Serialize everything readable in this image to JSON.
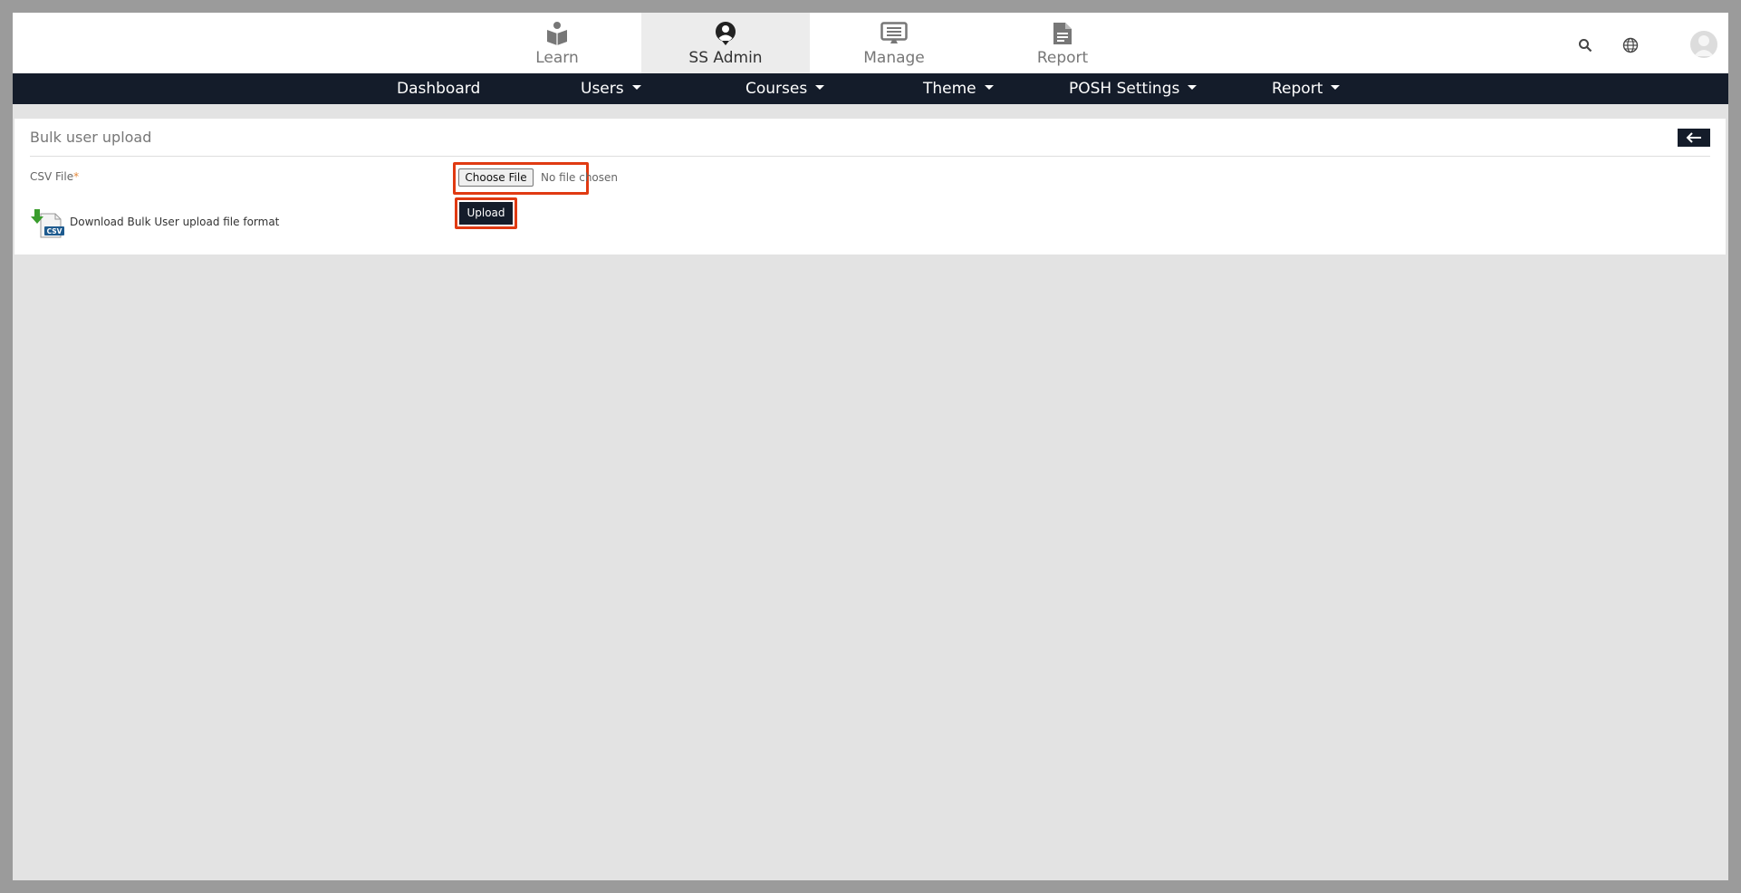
{
  "top_tabs": [
    {
      "label": "Learn",
      "icon": "reader-book-icon"
    },
    {
      "label": "SS Admin",
      "icon": "user-pin-icon",
      "active": true
    },
    {
      "label": "Manage",
      "icon": "monitor-list-icon"
    },
    {
      "label": "Report",
      "icon": "document-icon"
    }
  ],
  "top_right": {
    "search_icon": "search-icon",
    "language_icon": "globe-icon",
    "avatar_icon": "avatar"
  },
  "nav": {
    "dashboard": "Dashboard",
    "users": "Users",
    "courses": "Courses",
    "theme": "Theme",
    "posh_settings": "POSH Settings",
    "report": "Report"
  },
  "panel": {
    "title": "Bulk user upload",
    "back_icon": "arrow-left-icon",
    "csv_label": "CSV File",
    "required_mark": "*",
    "choose_file": "Choose File",
    "no_file": "No file chosen",
    "upload": "Upload",
    "download_link": "Download Bulk User upload file format",
    "download_icon_text": "CSV"
  },
  "colors": {
    "navbar": "#141c2a",
    "highlight": "#e03a12",
    "required": "#e4893c",
    "page_bg": "#e3e3e3"
  }
}
